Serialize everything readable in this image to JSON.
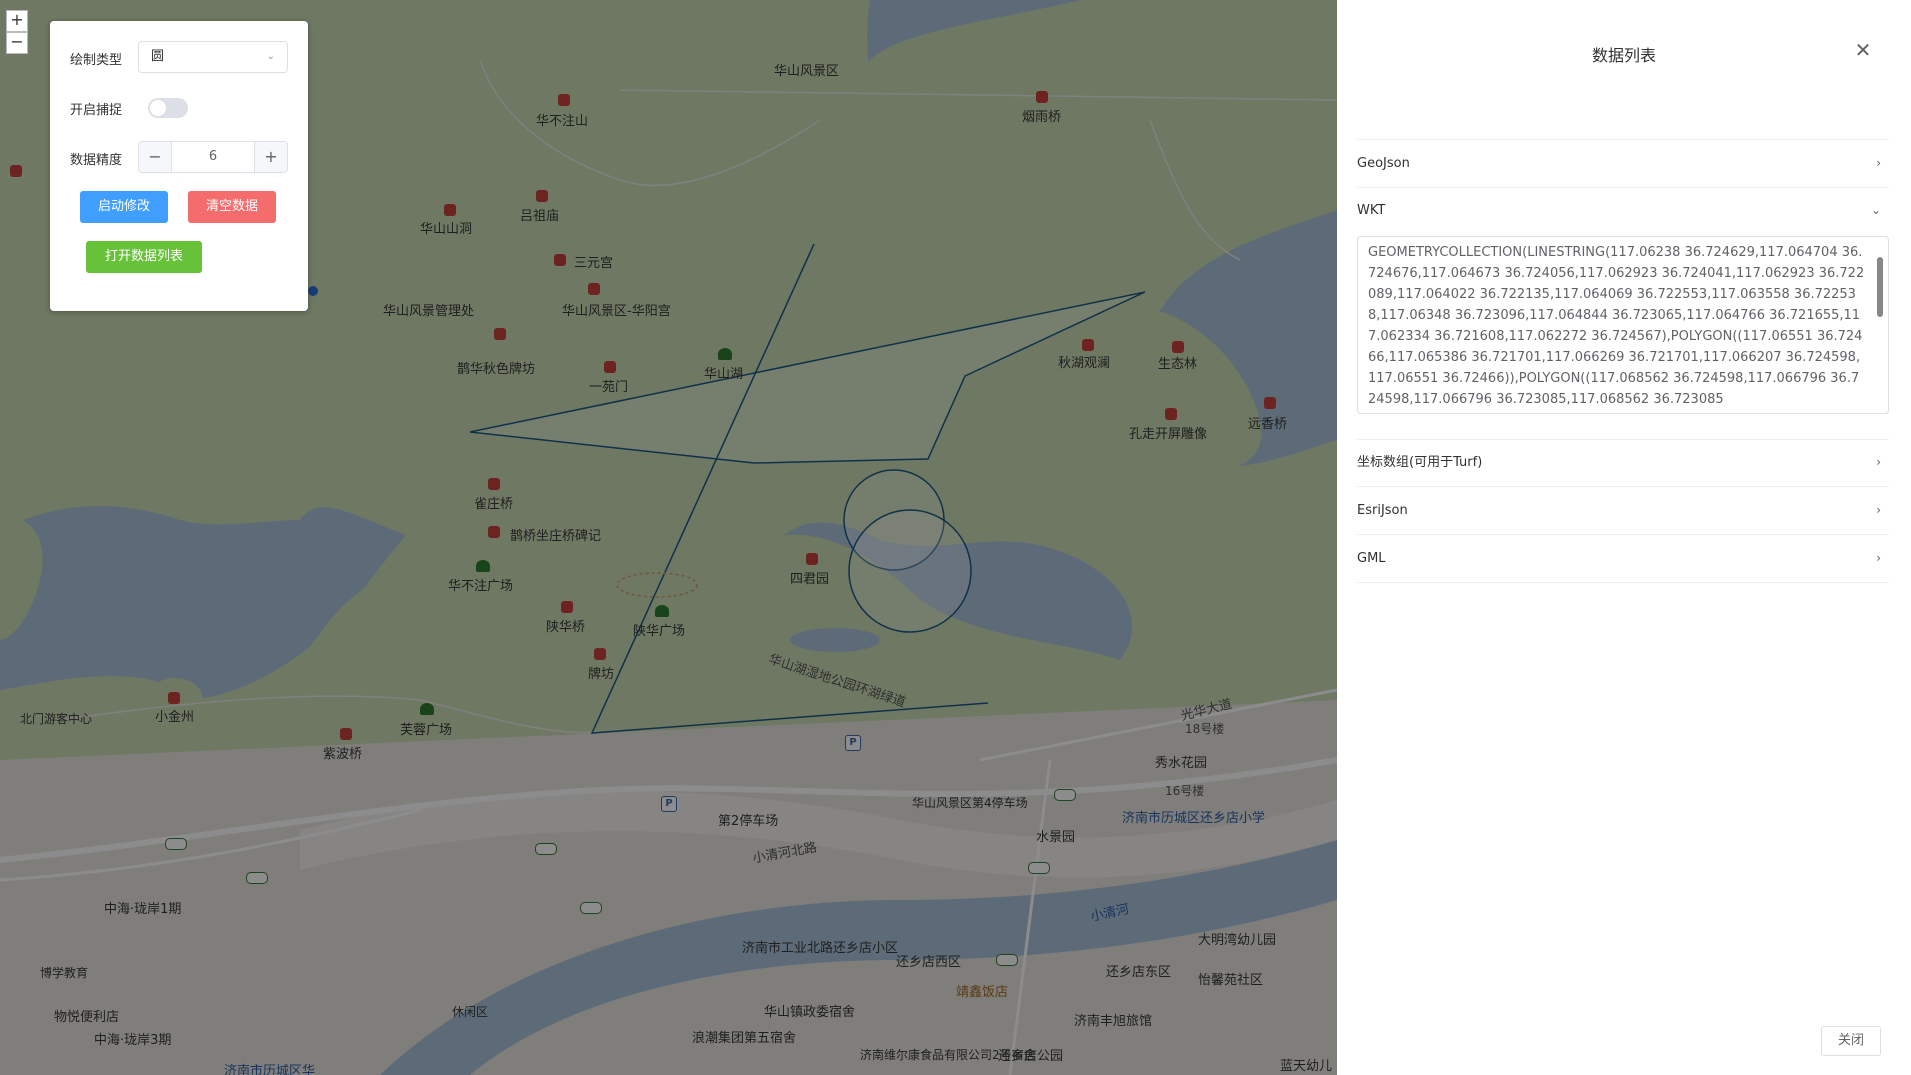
{
  "map": {
    "zoom_in": "+",
    "zoom_out": "−",
    "labels": {
      "huashan_scenic": "华山风景区",
      "huabuzhushan": "华不注山",
      "huashan_cave": "华山山洞",
      "lvzumiao": "吕祖庙",
      "sanyuangong": "三元宫",
      "huashan_huayangong": "华山风景区-华阳宫",
      "huashan_square_sub": "华山风景管理处",
      "quehua_qiuse": "鹊华秋色牌坊",
      "yiyuanmen": "一苑门",
      "huashan_lake": "华山湖",
      "qiuhu_guanlan": "秋湖观澜",
      "shengtailin": "生态林",
      "kongjiang_diaosu": "孔走开屏雕像",
      "yuanxiangqiao": "远香桥",
      "yanyuqiao": "烟雨桥",
      "queqiao": "雀庄桥",
      "quehua_bridge_note": "鹊桥坐庄桥碑记",
      "huabuzhu_square": "华不注广场",
      "shanhuaqiao": "陕华桥",
      "quehua_square": "陕华广场",
      "siyuan": "四君园",
      "paifang": "牌坊",
      "xiaojinzhou": "小金州",
      "furong_square": "芙蓉广场",
      "zibo_bridge": "紫波桥",
      "north_gate": "北门游客中心",
      "huashan_lake_road": "华山湖湿地公园环湖绿道",
      "guanghua_road": "光华大道",
      "building_18": "18号楼",
      "xiushui": "秀水花园",
      "building_16": "16号楼",
      "school": "济南市历城区还乡店小学",
      "shuijingyuan": "水景园",
      "parking_2": "第2停车场",
      "scenic_4th": "华山风景区第4停车场",
      "xiaoqinghe_north": "小清河北路",
      "xiaoqinghe": "小清河",
      "gongye_north": "济南市工业北路还乡店小区",
      "huanxiang_west": "还乡店西区",
      "huanxiang_east": "还乡店东区",
      "jingxin_hotel": "靖鑫饭店",
      "huashan_town": "华山镇政委宿舍",
      "bridge_5": "济南丰旭旅馆",
      "daming_kindergarten": "大明湾幼儿园",
      "yiyang_community": "怡馨苑社区",
      "tiannan_food": "济南维尔康食品有限公司2号宿舍",
      "huanxiang_park": "还乡店公园",
      "huanjia": "蓝天幼儿",
      "langu_wugongsu": "浪潮集团第五宿舍",
      "zhonghai_1": "中海·珑岸1期",
      "zhonghai_3": "中海·珑岸3期",
      "yuejia": "物悦便利店",
      "bochuang": "博学教育",
      "jinan_lixia": "济南市历城区华",
      "waterside": "休闲区"
    }
  },
  "panel": {
    "draw_type_label": "绘制类型",
    "draw_type_value": "圆",
    "snap_label": "开启捕捉",
    "precision_label": "数据精度",
    "precision_value": "6",
    "minus": "−",
    "plus": "+",
    "start_edit": "启动修改",
    "clear_data": "清空数据",
    "open_list": "打开数据列表",
    "colors": {
      "primary": "#409eff",
      "danger": "#f56c6c",
      "success": "#67c23a"
    }
  },
  "drawer": {
    "title": "数据列表",
    "close_icon": "close-icon",
    "items": [
      {
        "label": "GeoJson",
        "expanded": false
      },
      {
        "label": "WKT",
        "expanded": true
      },
      {
        "label": "坐标数组(可用于Turf)",
        "expanded": false
      },
      {
        "label": "EsriJson",
        "expanded": false
      },
      {
        "label": "GML",
        "expanded": false
      }
    ],
    "wkt_text": "GEOMETRYCOLLECTION(LINESTRING(117.06238 36.724629,117.064704 36.724676,117.064673 36.724056,117.062923 36.724041,117.062923 36.722089,117.064022 36.722135,117.064069 36.722553,117.063558 36.722538,117.06348 36.723096,117.064844 36.723065,117.064766 36.721655,117.062334 36.721608,117.062272 36.724567),POLYGON((117.06551 36.72466,117.065386 36.721701,117.066269 36.721701,117.066207 36.724598,117.06551 36.72466)),POLYGON((117.068562 36.724598,117.066796 36.724598,117.066796 36.723085,117.068562 36.723085",
    "close_button": "关闭"
  }
}
